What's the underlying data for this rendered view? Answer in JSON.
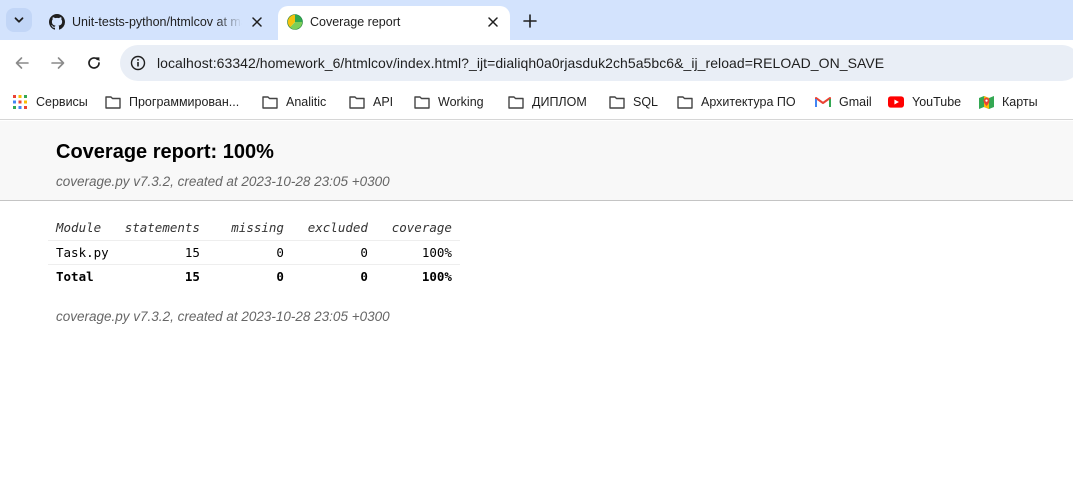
{
  "browser": {
    "tabs": [
      {
        "title": "Unit-tests-python/htmlcov at main",
        "favicon": "github-icon",
        "active": false
      },
      {
        "title": "Coverage report",
        "favicon": "coverage-icon",
        "active": true
      }
    ],
    "url": "localhost:63342/homework_6/htmlcov/index.html?_ijt=dialiqh0a0rjasduk2ch5a5bc6&_ij_reload=RELOAD_ON_SAVE",
    "bookmarks": [
      {
        "label": "Сервисы",
        "icon": "apps-grid-icon"
      },
      {
        "label": "Программирован...",
        "icon": "folder-icon"
      },
      {
        "label": "Analitic",
        "icon": "folder-icon"
      },
      {
        "label": "API",
        "icon": "folder-icon"
      },
      {
        "label": "Working",
        "icon": "folder-icon"
      },
      {
        "label": "ДИПЛОМ",
        "icon": "folder-icon"
      },
      {
        "label": "SQL",
        "icon": "folder-icon"
      },
      {
        "label": "Архитектура ПО",
        "icon": "folder-icon"
      },
      {
        "label": "Gmail",
        "icon": "gmail-icon"
      },
      {
        "label": "YouTube",
        "icon": "youtube-icon"
      },
      {
        "label": "Карты",
        "icon": "maps-icon"
      }
    ],
    "colors": {
      "tabstrip": "#d3e3fd",
      "omnibox": "#e9eef6",
      "youtube": "#ff0000",
      "gmail": "#ea4335"
    }
  },
  "report": {
    "title": "Coverage report: 100%",
    "subtitle": "coverage.py v7.3.2, created at 2023-10-28 23:05 +0300",
    "columns": [
      "Module",
      "statements",
      "missing",
      "excluded",
      "coverage"
    ],
    "rows": [
      {
        "module": "Task.py",
        "statements": "15",
        "missing": "0",
        "excluded": "0",
        "coverage": "100%"
      }
    ],
    "total": {
      "module": "Total",
      "statements": "15",
      "missing": "0",
      "excluded": "0",
      "coverage": "100%"
    },
    "footer": "coverage.py v7.3.2, created at 2023-10-28 23:05 +0300"
  }
}
